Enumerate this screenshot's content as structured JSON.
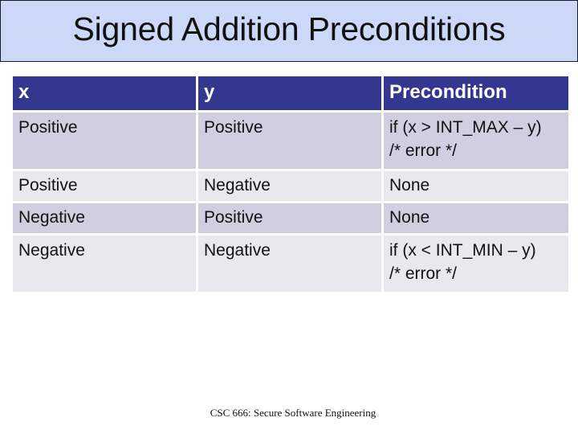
{
  "slide": {
    "title": "Signed Addition Preconditions",
    "footer": "CSC 666: Secure Software Engineering"
  },
  "table": {
    "headers": [
      "x",
      "y",
      "Precondition"
    ],
    "rows": [
      {
        "x": "Positive",
        "y": "Positive",
        "precondition_line1": "if (x > INT_MAX – y)",
        "precondition_line2": "/* error */"
      },
      {
        "x": "Positive",
        "y": "Negative",
        "precondition_line1": "None",
        "precondition_line2": ""
      },
      {
        "x": "Negative",
        "y": "Positive",
        "precondition_line1": "None",
        "precondition_line2": ""
      },
      {
        "x": "Negative",
        "y": "Negative",
        "precondition_line1": "if (x < INT_MIN – y)",
        "precondition_line2": "/* error */"
      }
    ]
  },
  "colors": {
    "title_bg": "#ccd8f7",
    "header_bg": "#34378f",
    "row_odd_bg": "#cfcfdf",
    "row_even_bg": "#e8e8ee"
  }
}
